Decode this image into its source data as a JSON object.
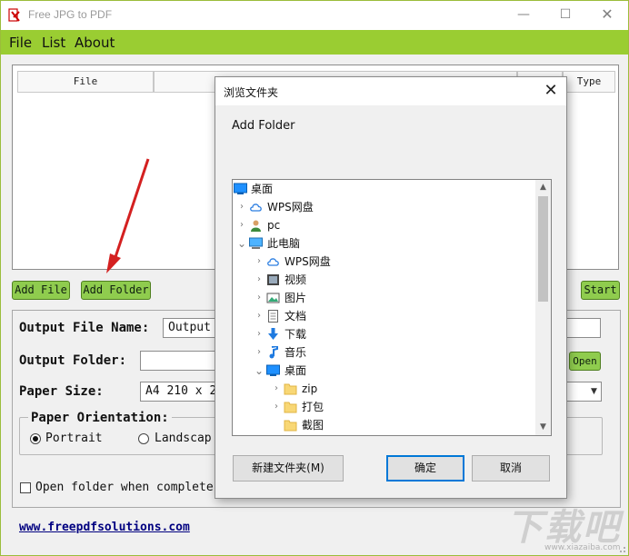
{
  "app": {
    "title": "Free JPG to PDF",
    "window_controls": [
      "minimize-icon",
      "maximize-icon",
      "close-icon"
    ],
    "menu": [
      "File",
      "List",
      "About"
    ],
    "accent": "#9acd32"
  },
  "file_list": {
    "columns": [
      "File",
      "",
      "",
      "Type"
    ]
  },
  "buttons": {
    "add_file": "Add File",
    "add_folder": "Add Folder",
    "start": "Start",
    "open": "Open"
  },
  "form": {
    "output_file_name_label": "Output File Name:",
    "output_file_name_value": "Output",
    "output_folder_label": "Output Folder:",
    "output_folder_value": "",
    "paper_size_label": "Paper Size:",
    "paper_size_value": "A4 210 x 2",
    "orientation_label": "Paper Orientation:",
    "portrait": "Portrait",
    "landscape": "Landscap",
    "open_when_complete": "Open folder when complete"
  },
  "footer": {
    "website": "www.freepdfsolutions.com"
  },
  "dialog": {
    "title": "浏览文件夹",
    "description": "Add Folder",
    "tree": [
      {
        "label": "桌面",
        "icon": "desktop-icon",
        "indent": 0,
        "chevron": ""
      },
      {
        "label": "WPS网盘",
        "icon": "cloud-icon",
        "indent": 1,
        "chevron": "›"
      },
      {
        "label": "pc",
        "icon": "user-icon",
        "indent": 1,
        "chevron": "›"
      },
      {
        "label": "此电脑",
        "icon": "computer-icon",
        "indent": 1,
        "chevron": "⌄"
      },
      {
        "label": "WPS网盘",
        "icon": "cloud-icon",
        "indent": 2,
        "chevron": "›"
      },
      {
        "label": "视频",
        "icon": "video-icon",
        "indent": 2,
        "chevron": "›"
      },
      {
        "label": "图片",
        "icon": "picture-icon",
        "indent": 2,
        "chevron": "›"
      },
      {
        "label": "文档",
        "icon": "document-icon",
        "indent": 2,
        "chevron": "›"
      },
      {
        "label": "下载",
        "icon": "download-icon",
        "indent": 2,
        "chevron": "›"
      },
      {
        "label": "音乐",
        "icon": "music-icon",
        "indent": 2,
        "chevron": "›"
      },
      {
        "label": "桌面",
        "icon": "desktop-icon",
        "indent": 2,
        "chevron": "⌄"
      },
      {
        "label": "zip",
        "icon": "folder-icon",
        "indent": 3,
        "chevron": "›"
      },
      {
        "label": "打包",
        "icon": "folder-icon",
        "indent": 3,
        "chevron": "›"
      },
      {
        "label": "截图",
        "icon": "folder-icon",
        "indent": 3,
        "chevron": ""
      }
    ],
    "new_folder": "新建文件夹(M)",
    "ok": "确定",
    "cancel": "取消"
  },
  "watermark": {
    "text": "下载吧",
    "url": "www.xiazaiba.com"
  }
}
